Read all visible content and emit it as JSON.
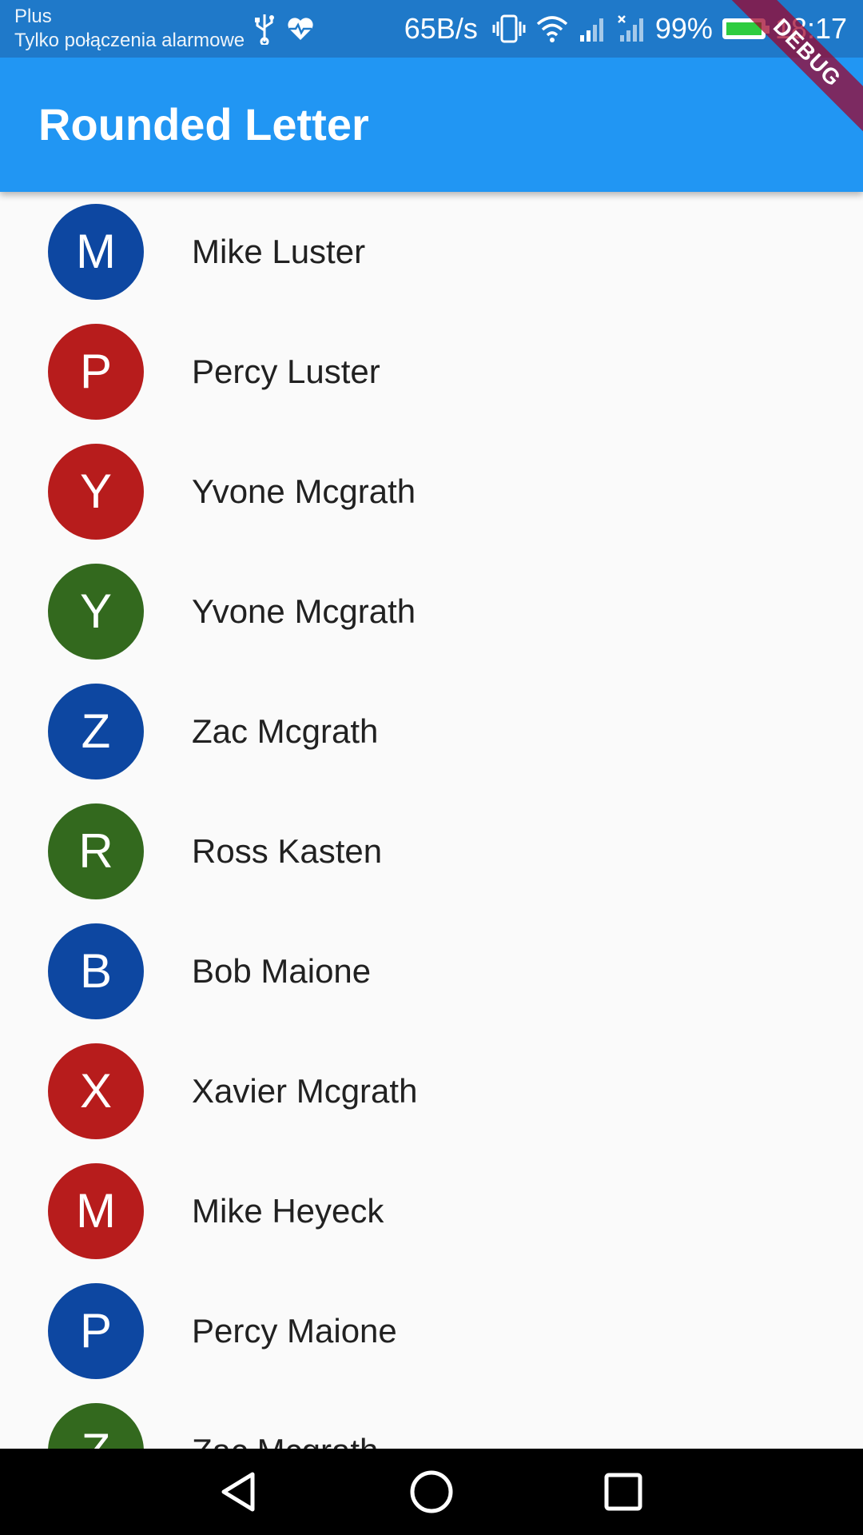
{
  "status_bar": {
    "carrier": "Plus",
    "carrier_sub": "Tylko połączenia alarmowe",
    "net_speed": "65B/s",
    "battery": "99%",
    "time": "18:17",
    "battery_fill_color": "#2ecc40"
  },
  "debug_banner": "DEBUG",
  "app_bar": {
    "title": "Rounded Letter",
    "color": "#2196f3"
  },
  "colors": {
    "blue": "#0d47a1",
    "red": "#b71c1c",
    "green": "#33691e"
  },
  "contacts": [
    {
      "initial": "M",
      "name": "Mike Luster",
      "color": "#0d47a1"
    },
    {
      "initial": "P",
      "name": "Percy Luster",
      "color": "#b71c1c"
    },
    {
      "initial": "Y",
      "name": "Yvone Mcgrath",
      "color": "#b71c1c"
    },
    {
      "initial": "Y",
      "name": "Yvone Mcgrath",
      "color": "#33691e"
    },
    {
      "initial": "Z",
      "name": "Zac Mcgrath",
      "color": "#0d47a1"
    },
    {
      "initial": "R",
      "name": "Ross Kasten",
      "color": "#33691e"
    },
    {
      "initial": "B",
      "name": "Bob Maione",
      "color": "#0d47a1"
    },
    {
      "initial": "X",
      "name": "Xavier Mcgrath",
      "color": "#b71c1c"
    },
    {
      "initial": "M",
      "name": "Mike Heyeck",
      "color": "#b71c1c"
    },
    {
      "initial": "P",
      "name": "Percy Maione",
      "color": "#0d47a1"
    },
    {
      "initial": "Z",
      "name": "Zac Mcgrath",
      "color": "#33691e"
    }
  ],
  "nav_icons": [
    "back-triangle-icon",
    "home-circle-icon",
    "recents-square-icon"
  ]
}
